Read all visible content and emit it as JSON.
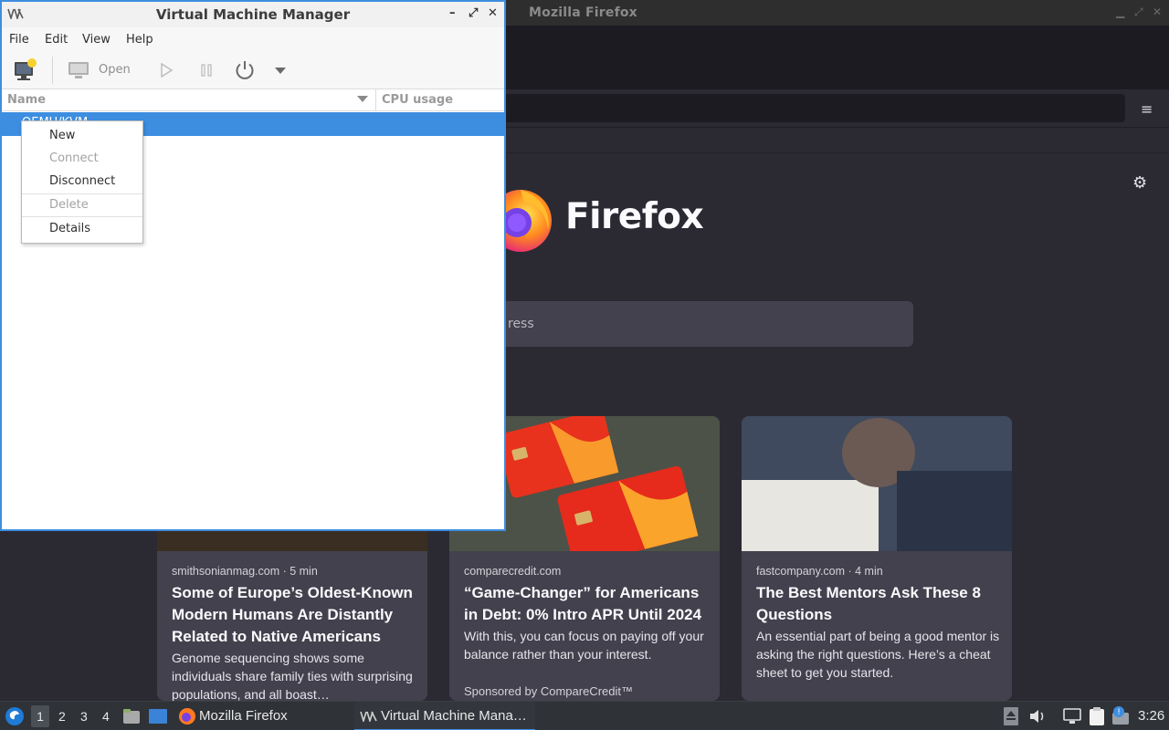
{
  "firefox": {
    "window_title": "Mozilla Firefox",
    "brand": "Firefox",
    "search_placeholder_visible": "ress",
    "cards": [
      {
        "source": "smithsonianmag.com · 5 min",
        "title": "Some of Europe’s Oldest-Known Modern Humans Are Distantly Related to Native Americans",
        "description": "Genome sequencing shows some individuals share family ties with surprising populations, and all boast…"
      },
      {
        "source": "comparecredit.com",
        "title": "“Game-Changer” for Americans in Debt: 0% Intro APR Until 2024",
        "description": "With this, you can focus on paying off your balance rather than your interest.",
        "sponsor": "Sponsored by CompareCredit™"
      },
      {
        "source": "fastcompany.com · 4 min",
        "title": "The Best Mentors Ask These 8 Questions",
        "description": "An essential part of being a good mentor is asking the right questions. Here’s a cheat sheet to get you started."
      }
    ]
  },
  "vmm": {
    "title": "Virtual Machine Manager",
    "menu": [
      "File",
      "Edit",
      "View",
      "Help"
    ],
    "toolbar": {
      "open_label": "Open",
      "icons": [
        "new-vm-icon",
        "monitor-icon",
        "play-icon",
        "pause-icon",
        "power-icon",
        "dropdown-arrow-icon"
      ]
    },
    "columns": {
      "name": "Name",
      "cpu": "CPU usage"
    },
    "selected_row": "QEMU/KVM",
    "context_menu": [
      {
        "label": "New",
        "enabled": true
      },
      {
        "label": "Connect",
        "enabled": false
      },
      {
        "label": "Disconnect",
        "enabled": true
      },
      {
        "label": "Delete",
        "enabled": false
      },
      {
        "label": "Details",
        "enabled": true
      }
    ]
  },
  "taskbar": {
    "workspaces": [
      "1",
      "2",
      "3",
      "4"
    ],
    "tasks": [
      "Mozilla Firefox",
      "Virtual Machine Mana…"
    ],
    "clock": "3:26"
  },
  "colors": {
    "accent": "#3d8ee0",
    "firefox_bg": "#2b2a33",
    "card_bg": "#42414d",
    "taskbar_bg": "#2f3237"
  }
}
